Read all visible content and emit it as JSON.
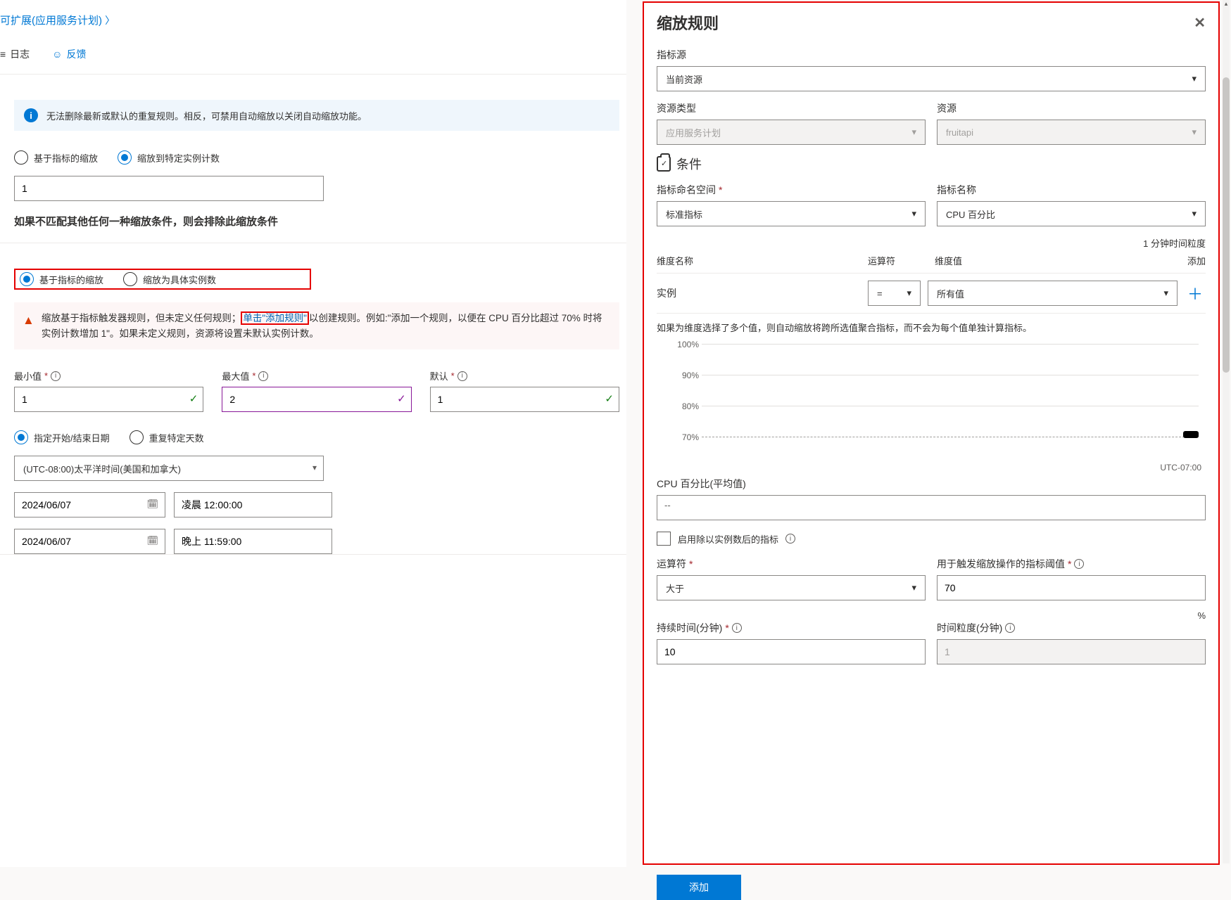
{
  "breadcrumb": {
    "link": "可扩展(应用服务计划)"
  },
  "toolbar": {
    "logs": "日志",
    "feedback": "反馈"
  },
  "info_message": "无法删除最新或默认的重复规则。相反，可禁用自动缩放以关闭自动缩放功能。",
  "scale_mode1": {
    "opt1": "基于指标的缩放",
    "opt2": "缩放到特定实例计数",
    "count_value": "1",
    "exclude_text": "如果不匹配其他任何一种缩放条件，则会排除此缩放条件"
  },
  "scale_mode2": {
    "opt1": "基于指标的缩放",
    "opt2": "缩放为具体实例数"
  },
  "warning": {
    "pre": "缩放基于指标触发器规则，但未定义任何规则；",
    "link": "单击\"添加规则\"",
    "post": "以创建规则。例如:\"添加一个规则，以便在 CPU 百分比超过 70% 时将实例计数增加 1\"。如果未定义规则，资源将设置未默认实例计数。"
  },
  "limits": {
    "min_label": "最小值",
    "min_value": "1",
    "max_label": "最大值",
    "max_value": "2",
    "def_label": "默认",
    "def_value": "1"
  },
  "schedule": {
    "opt1": "指定开始/结束日期",
    "opt2": "重复特定天数",
    "timezone": "(UTC-08:00)太平洋时间(美国和加拿大)",
    "start_date": "2024/06/07",
    "start_time": "凌晨 12:00:00",
    "end_date": "2024/06/07",
    "end_time": "晚上 11:59:00"
  },
  "panel": {
    "title": "缩放规则",
    "src_label": "指标源",
    "src_value": "当前资源",
    "res_type_label": "资源类型",
    "res_type_value": "应用服务计划",
    "res_label": "资源",
    "res_value": "fruitapi",
    "condition": "条件",
    "ns_label": "指标命名空间",
    "ns_value": "标准指标",
    "metric_label": "指标名称",
    "metric_value": "CPU 百分比",
    "gran_note": "1 分钟时间粒度",
    "dim_name_h": "维度名称",
    "op_h": "运算符",
    "val_h": "维度值",
    "add_h": "添加",
    "dim_name": "实例",
    "dim_op": "=",
    "dim_val": "所有值",
    "dim_note": "如果为维度选择了多个值，则自动缩放将跨所选值聚合指标，而不会为每个值单独计算指标。",
    "avg_label": "CPU 百分比(平均值)",
    "avg_value": "--",
    "divide_label": "启用除以实例数后的指标",
    "oper_label": "运算符",
    "oper_value": "大于",
    "thresh_label": "用于触发缩放操作的指标阈值",
    "thresh_value": "70",
    "percent": "%",
    "dur_label": "持续时间(分钟)",
    "dur_value": "10",
    "grain_label": "时间粒度(分钟)",
    "grain_value": "1",
    "add_btn": "添加"
  },
  "chart_data": {
    "type": "line",
    "title": "",
    "y_ticks": [
      "100%",
      "90%",
      "80%",
      "70%"
    ],
    "ylim": [
      70,
      100
    ],
    "tz": "UTC-07:00",
    "series": [
      {
        "name": "CPU",
        "values": []
      }
    ]
  }
}
